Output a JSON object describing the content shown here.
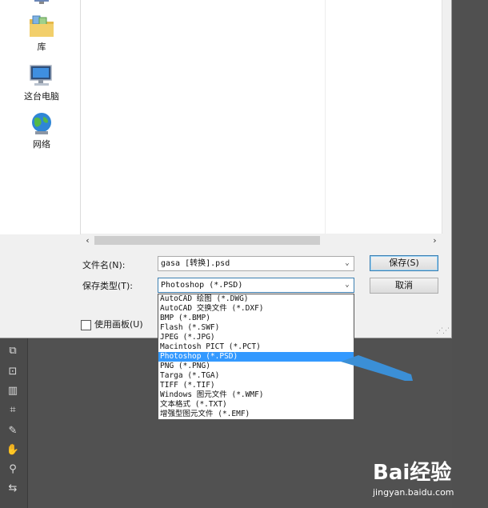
{
  "nav": {
    "items": [
      {
        "label": "",
        "icon": "desktop-icon"
      },
      {
        "label": "库",
        "icon": "library-icon"
      },
      {
        "label": "这台电脑",
        "icon": "computer-icon"
      },
      {
        "label": "网络",
        "icon": "network-icon"
      }
    ]
  },
  "form": {
    "filename_label": "文件名(N):",
    "filename_value": "gasa [转换].psd",
    "filetype_label": "保存类型(T):",
    "filetype_value": "Photoshop (*.PSD)",
    "use_artboard_label": "使用画板(U)",
    "use_artboard_checked": false
  },
  "buttons": {
    "save": "保存(S)",
    "cancel": "取消"
  },
  "dropdown": {
    "options": [
      "AutoCAD 绘图 (*.DWG)",
      "AutoCAD 交换文件 (*.DXF)",
      "BMP (*.BMP)",
      "Flash (*.SWF)",
      "JPEG (*.JPG)",
      "Macintosh PICT (*.PCT)",
      "Photoshop (*.PSD)",
      "PNG (*.PNG)",
      "Targa (*.TGA)",
      "TIFF (*.TIF)",
      "Windows 图元文件 (*.WMF)",
      "文本格式 (*.TXT)",
      "增强型图元文件 (*.EMF)"
    ],
    "selected_index": 6
  },
  "watermark": {
    "brand": "Bai经验",
    "url": "jingyan.baidu.com"
  },
  "colors": {
    "selection": "#3399ff",
    "callout": "#3b8fd6",
    "ps_background": "#515151"
  }
}
